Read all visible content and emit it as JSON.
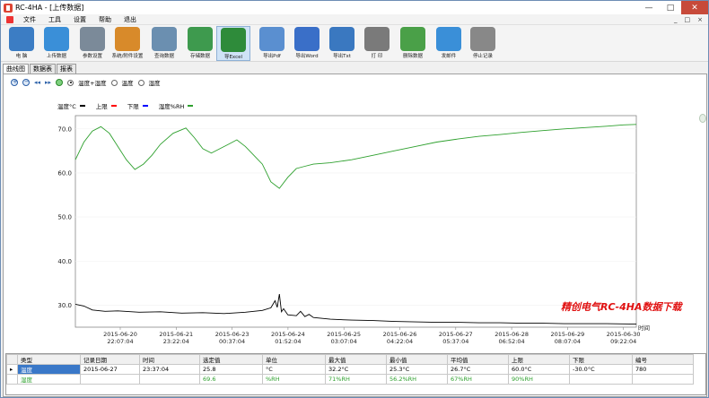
{
  "window": {
    "title": "RC-4HA - [上传数据]"
  },
  "menu": {
    "items": [
      "文件",
      "工具",
      "设置",
      "帮助",
      "退出"
    ],
    "mdi_controls": [
      "_",
      "□",
      "×"
    ]
  },
  "toolbar": [
    {
      "label": "电  脑",
      "icon": "computer-icon",
      "color": "#3c7dc4"
    },
    {
      "label": "上传数据",
      "icon": "upload-icon",
      "color": "#3a8fd8"
    },
    {
      "label": "参数设置",
      "icon": "gears-icon",
      "color": "#7b8a99"
    },
    {
      "label": "系统/附件设置",
      "icon": "disc-icon",
      "color": "#d88a2a"
    },
    {
      "label": "查询数据",
      "icon": "query-icon",
      "color": "#6b8fb0"
    },
    {
      "label": "存储数据",
      "icon": "folder-icon",
      "color": "#3e9a4e"
    },
    {
      "label": "导Excel",
      "icon": "excel-icon",
      "color": "#2e8b3a"
    },
    {
      "label": "导出Pdf",
      "icon": "pdf-icon",
      "color": "#5a8fd0"
    },
    {
      "label": "导出Word",
      "icon": "word-icon",
      "color": "#3a6fc8"
    },
    {
      "label": "导出Txt",
      "icon": "txt-icon",
      "color": "#3a78c0"
    },
    {
      "label": "打  印",
      "icon": "printer-icon",
      "color": "#7a7a7a"
    },
    {
      "label": "删除数据",
      "icon": "trash-icon",
      "color": "#4aa048"
    },
    {
      "label": "发邮件",
      "icon": "mail-icon",
      "color": "#3a8fd8"
    },
    {
      "label": "停止记录",
      "icon": "stop-icon",
      "color": "#888888"
    }
  ],
  "tabs": [
    "曲线图",
    "数据表",
    "报表"
  ],
  "controls": {
    "options": [
      "温度+湿度",
      "温度",
      "湿度"
    ],
    "selected": 0
  },
  "legend": [
    {
      "label": "温度°C",
      "color": "#000000"
    },
    {
      "label": "上限",
      "color": "#ff0000"
    },
    {
      "label": "下限",
      "color": "#0000ff"
    },
    {
      "label": "湿度%RH",
      "color": "#2ea02e"
    }
  ],
  "chart_data": {
    "type": "line",
    "xlabel": "时间",
    "ylim": [
      25,
      73
    ],
    "yticks": [
      "70.0",
      "60.0",
      "50.0",
      "40.0",
      "30.0"
    ],
    "ytick_values": [
      70,
      60,
      50,
      40,
      30
    ],
    "xticks": [
      [
        "2015-06-20",
        "22:07:04"
      ],
      [
        "2015-06-21",
        "23:22:04"
      ],
      [
        "2015-06-23",
        "00:37:04"
      ],
      [
        "2015-06-24",
        "01:52:04"
      ],
      [
        "2015-06-25",
        "03:07:04"
      ],
      [
        "2015-06-26",
        "04:22:04"
      ],
      [
        "2015-06-27",
        "05:37:04"
      ],
      [
        "2015-06-28",
        "06:52:04"
      ],
      [
        "2015-06-29",
        "08:07:04"
      ],
      [
        "2015-06-30",
        "09:22:04"
      ]
    ],
    "xrange_hours": [
      0,
      264
    ],
    "series": [
      {
        "name": "湿度%RH",
        "color": "#2ea02e",
        "points": [
          [
            0,
            63
          ],
          [
            4,
            67
          ],
          [
            8,
            69.5
          ],
          [
            12,
            70.5
          ],
          [
            16,
            69
          ],
          [
            20,
            66
          ],
          [
            24,
            63
          ],
          [
            28,
            60.8
          ],
          [
            32,
            62
          ],
          [
            36,
            64
          ],
          [
            40,
            66.5
          ],
          [
            46,
            69
          ],
          [
            52,
            70.2
          ],
          [
            56,
            68
          ],
          [
            60,
            65.5
          ],
          [
            64,
            64.5
          ],
          [
            68,
            65.5
          ],
          [
            72,
            66.5
          ],
          [
            76,
            67.5
          ],
          [
            80,
            66
          ],
          [
            84,
            64
          ],
          [
            88,
            62
          ],
          [
            92,
            58
          ],
          [
            96,
            56.5
          ],
          [
            100,
            59
          ],
          [
            104,
            61
          ],
          [
            108,
            61.5
          ],
          [
            112,
            62
          ],
          [
            120,
            62.3
          ],
          [
            130,
            63
          ],
          [
            140,
            64
          ],
          [
            150,
            65
          ],
          [
            160,
            66
          ],
          [
            170,
            67
          ],
          [
            180,
            67.7
          ],
          [
            190,
            68.3
          ],
          [
            200,
            68.7
          ],
          [
            210,
            69.2
          ],
          [
            220,
            69.6
          ],
          [
            230,
            70
          ],
          [
            240,
            70.3
          ],
          [
            250,
            70.6
          ],
          [
            258,
            70.9
          ],
          [
            264,
            71
          ]
        ]
      },
      {
        "name": "温度°C",
        "color": "#000000",
        "points": [
          [
            0,
            30.2
          ],
          [
            4,
            29.8
          ],
          [
            8,
            28.9
          ],
          [
            14,
            28.6
          ],
          [
            20,
            28.7
          ],
          [
            30,
            28.4
          ],
          [
            40,
            28.5
          ],
          [
            50,
            28.2
          ],
          [
            60,
            28.3
          ],
          [
            70,
            28.1
          ],
          [
            80,
            28.4
          ],
          [
            88,
            28.8
          ],
          [
            92,
            29.4
          ],
          [
            94,
            31
          ],
          [
            95,
            29.5
          ],
          [
            96,
            32.5
          ],
          [
            97,
            28.5
          ],
          [
            98,
            29.2
          ],
          [
            100,
            27.8
          ],
          [
            104,
            27.6
          ],
          [
            106,
            28.6
          ],
          [
            108,
            27.4
          ],
          [
            110,
            27.9
          ],
          [
            112,
            27.2
          ],
          [
            120,
            26.8
          ],
          [
            130,
            26.6
          ],
          [
            140,
            26.5
          ],
          [
            150,
            26.3
          ],
          [
            160,
            26.2
          ],
          [
            170,
            26.1
          ],
          [
            180,
            26.1
          ],
          [
            190,
            26
          ],
          [
            200,
            26
          ],
          [
            210,
            25.9
          ],
          [
            220,
            25.9
          ],
          [
            230,
            25.8
          ],
          [
            240,
            25.8
          ],
          [
            250,
            25.8
          ],
          [
            264,
            25.7
          ]
        ]
      }
    ]
  },
  "table": {
    "headers": [
      "类型",
      "记录日期",
      "时间",
      "选定值",
      "单位",
      "最大值",
      "最小值",
      "平均值",
      "上限",
      "下限",
      "编号"
    ],
    "rows": [
      {
        "marker": "▸",
        "cells": [
          "温度",
          "2015-06-27",
          "23:37:04",
          "25.8",
          "°C",
          "32.2°C",
          "25.3°C",
          "26.7°C",
          "60.0°C",
          "-30.0°C",
          "780"
        ],
        "color": "#000000"
      },
      {
        "marker": "",
        "cells": [
          "湿度",
          "",
          "",
          "69.6",
          "%RH",
          "71%RH",
          "56.2%RH",
          "67%RH",
          "90%RH",
          "",
          ""
        ],
        "color": "#2ea02e"
      }
    ]
  },
  "watermark": "精创电气RC-4HA数据下载"
}
